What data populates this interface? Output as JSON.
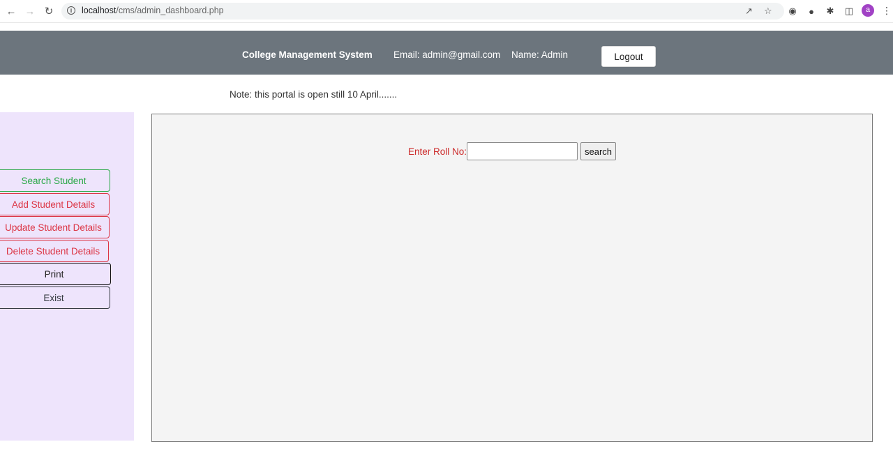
{
  "browser": {
    "url_host": "localhost",
    "url_path": "/cms/admin_dashboard.php",
    "profile_initial": "a"
  },
  "header": {
    "title": "College Management System",
    "email": "Email: admin@gmail.com",
    "name": "Name: Admin",
    "logout_label": "Logout"
  },
  "note": "Note: this portal is open still 10 April.......",
  "sidebar": {
    "items": [
      {
        "label": "Search Student"
      },
      {
        "label": "Add Student Details"
      },
      {
        "label": "Update Student Details"
      },
      {
        "label": "Delete Student Details"
      },
      {
        "label": "Print"
      },
      {
        "label": "Exist"
      }
    ]
  },
  "search": {
    "label": "Enter Roll No:",
    "value": "",
    "button_label": "search"
  },
  "colors": {
    "header_bg": "#6c757d",
    "sidebar_bg": "#eee4fc",
    "panel_bg": "#f4f4f4",
    "green": "#28a745",
    "red": "#dc3545",
    "label_red": "#cc2a2a"
  }
}
